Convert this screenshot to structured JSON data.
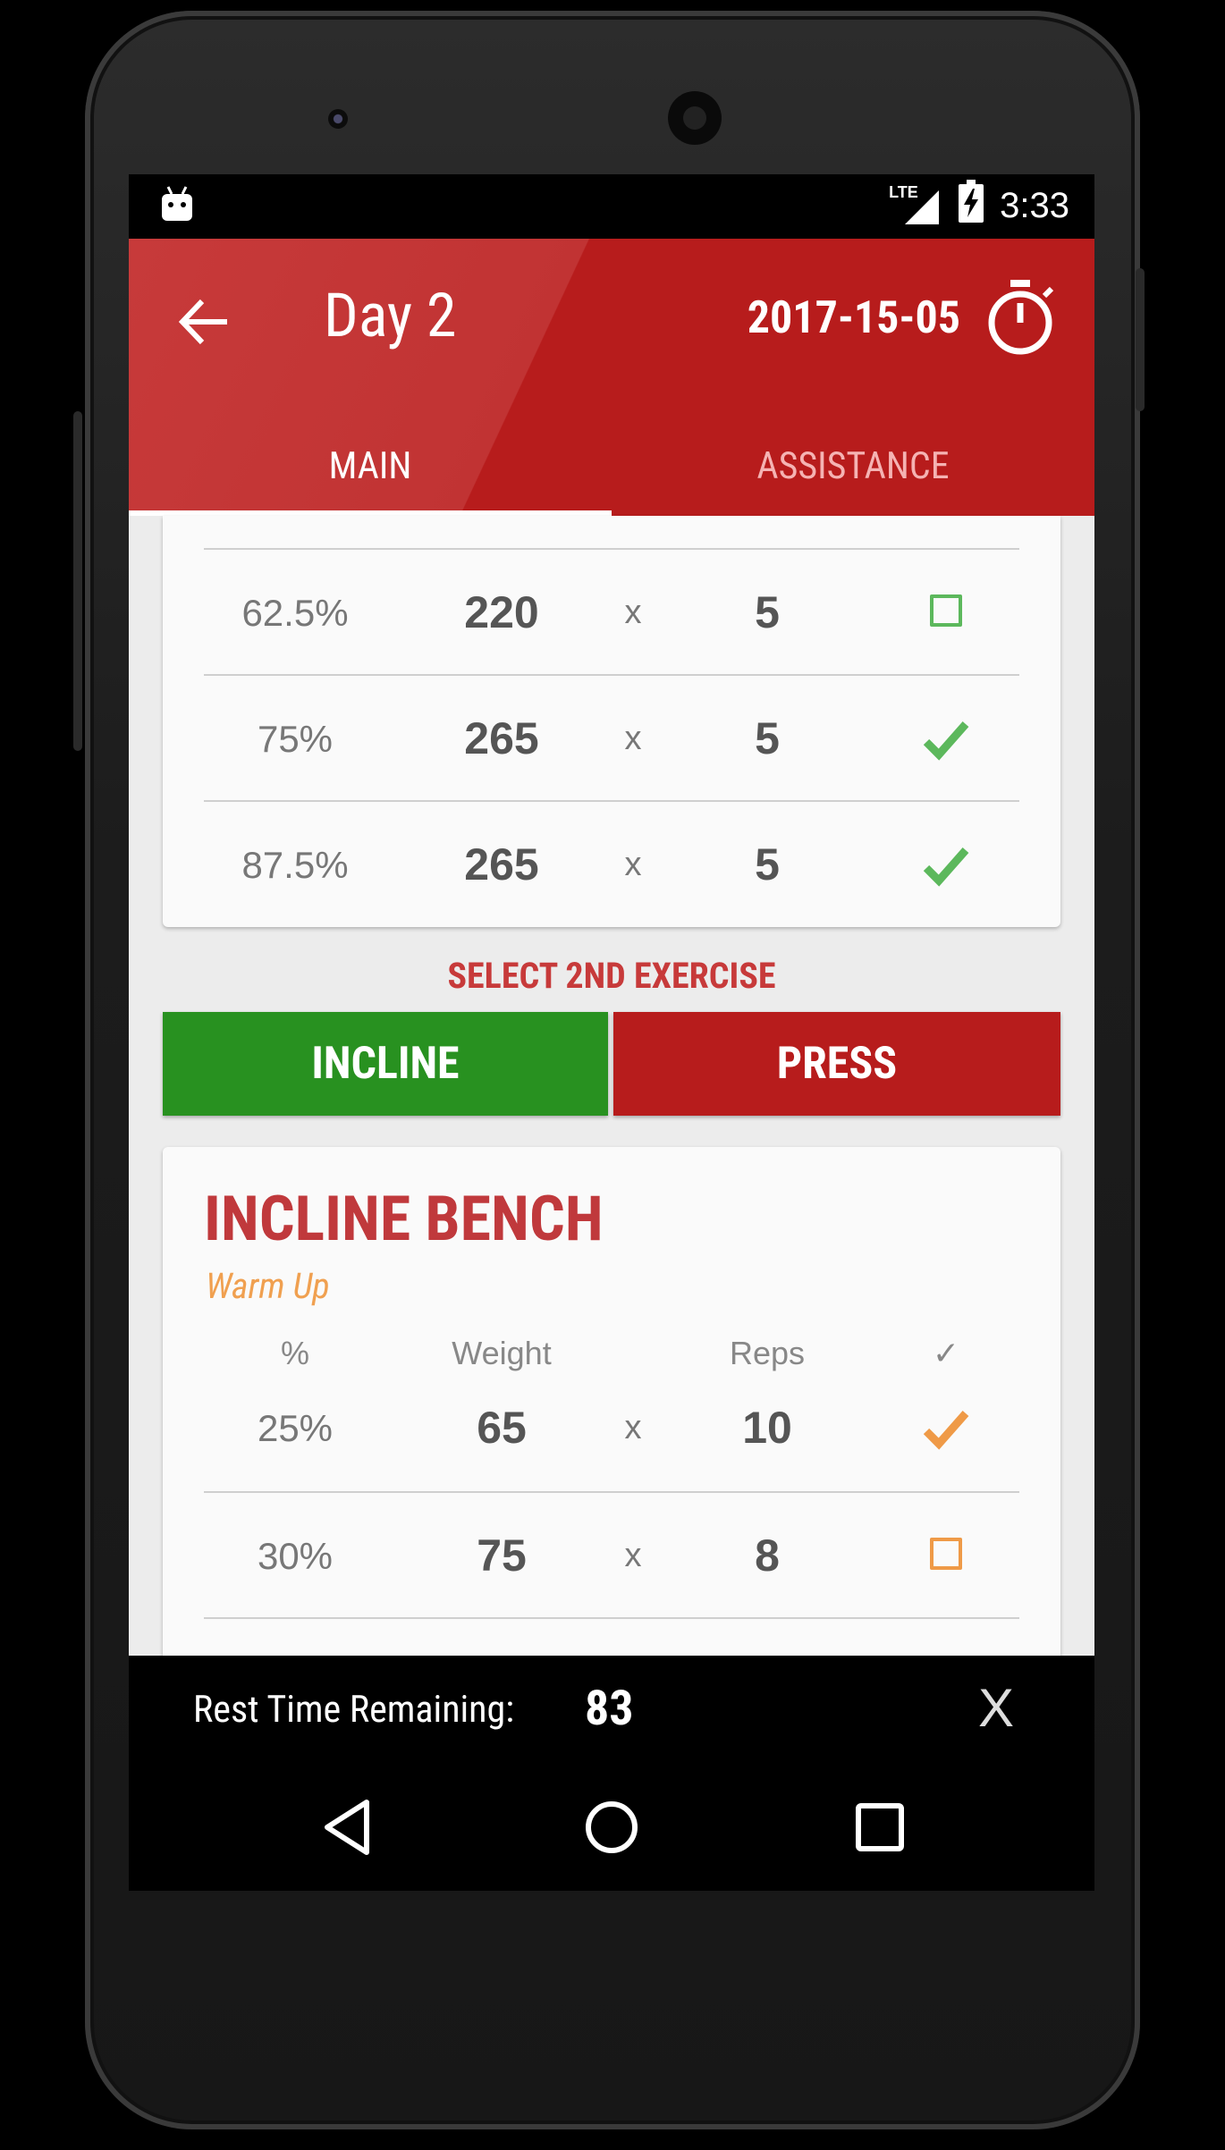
{
  "status": {
    "network": "LTE",
    "time": "3:33"
  },
  "header": {
    "title": "Day 2",
    "date": "2017-15-05"
  },
  "tabs": {
    "main": "MAIN",
    "assistance": "ASSISTANCE"
  },
  "main_sets": [
    {
      "percent": "62.5%",
      "weight": "220",
      "x": "x",
      "reps": "5",
      "checked": false
    },
    {
      "percent": "75%",
      "weight": "265",
      "x": "x",
      "reps": "5",
      "checked": true
    },
    {
      "percent": "87.5%",
      "weight": "265",
      "x": "x",
      "reps": "5",
      "checked": true
    }
  ],
  "select_exercise": {
    "label": "SELECT 2ND EXERCISE",
    "options": [
      "INCLINE",
      "PRESS"
    ]
  },
  "lift": {
    "title": "INCLINE BENCH",
    "subtitle": "Warm Up",
    "headers": {
      "percent": "%",
      "weight": "Weight",
      "reps": "Reps",
      "check": "✓"
    },
    "sets": [
      {
        "percent": "25%",
        "weight": "65",
        "x": "x",
        "reps": "10",
        "checked": true
      },
      {
        "percent": "30%",
        "weight": "75",
        "x": "x",
        "reps": "8",
        "checked": false
      }
    ]
  },
  "rest": {
    "label": "Rest Time Remaining:",
    "value": "83",
    "close": "X"
  },
  "colors": {
    "accent": "#b71c1c",
    "green": "#289120",
    "check_green": "#5cb85c",
    "orange": "#ef9a47"
  }
}
